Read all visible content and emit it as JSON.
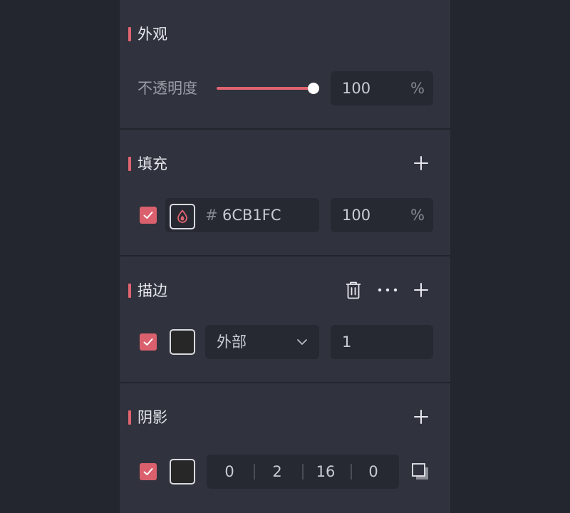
{
  "appearance": {
    "title": "外观",
    "opacity_label": "不透明度",
    "opacity_value": "100",
    "opacity_unit": "%",
    "opacity_level": 1.0
  },
  "fill": {
    "title": "填充",
    "hash": "#",
    "hex": "6CB1FC",
    "opacity": "100",
    "unit": "%",
    "checked": true
  },
  "stroke": {
    "title": "描边",
    "position": "外部",
    "width": "1",
    "checked": true
  },
  "shadow": {
    "title": "阴影",
    "values": [
      "0",
      "2",
      "16",
      "0"
    ],
    "checked": true
  },
  "icons": {
    "add": "plus-icon",
    "delete": "trash-icon",
    "more": "more-horizontal-icon",
    "dropdown": "chevron-down-icon",
    "color_picker": "droplet-icon",
    "shadow_type": "drop-shadow-icon",
    "check": "check-icon"
  },
  "colors": {
    "accent": "#E06470",
    "panel_bg": "#30323D",
    "page_bg": "#24262F",
    "input_bg": "#272932"
  }
}
